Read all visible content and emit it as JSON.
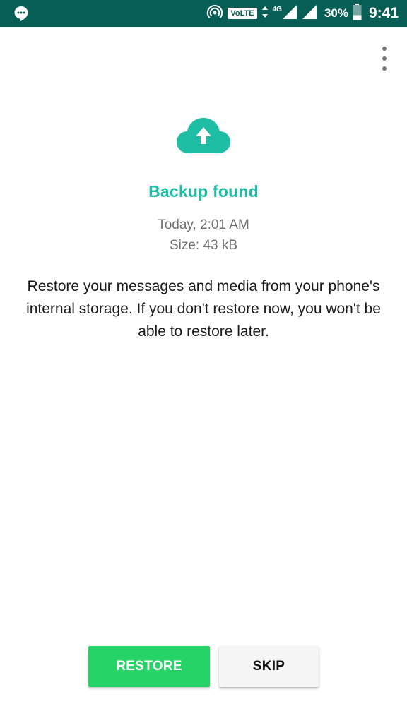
{
  "status_bar": {
    "volte": "VoLTE",
    "network": "4G",
    "battery": "30%",
    "time": "9:41",
    "icons": [
      "hangouts-icon",
      "hotspot-icon",
      "volte-icon",
      "data-arrows-icon",
      "signal-icon",
      "signal-icon-2",
      "battery-icon"
    ]
  },
  "menu": {
    "icon": "more-vert-icon"
  },
  "backup": {
    "icon": "cloud-upload-icon",
    "title": "Backup found",
    "date": "Today, 2:01 AM",
    "size": "Size: 43 kB",
    "description": "Restore your messages and media from your phone's internal storage. If you don't restore now, you won't be able to restore later."
  },
  "actions": {
    "restore_label": "RESTORE",
    "skip_label": "SKIP"
  },
  "colors": {
    "status_bar": "#075e54",
    "accent": "#1ebea5",
    "primary_button": "#25d366",
    "secondary_button": "#f5f5f5"
  }
}
